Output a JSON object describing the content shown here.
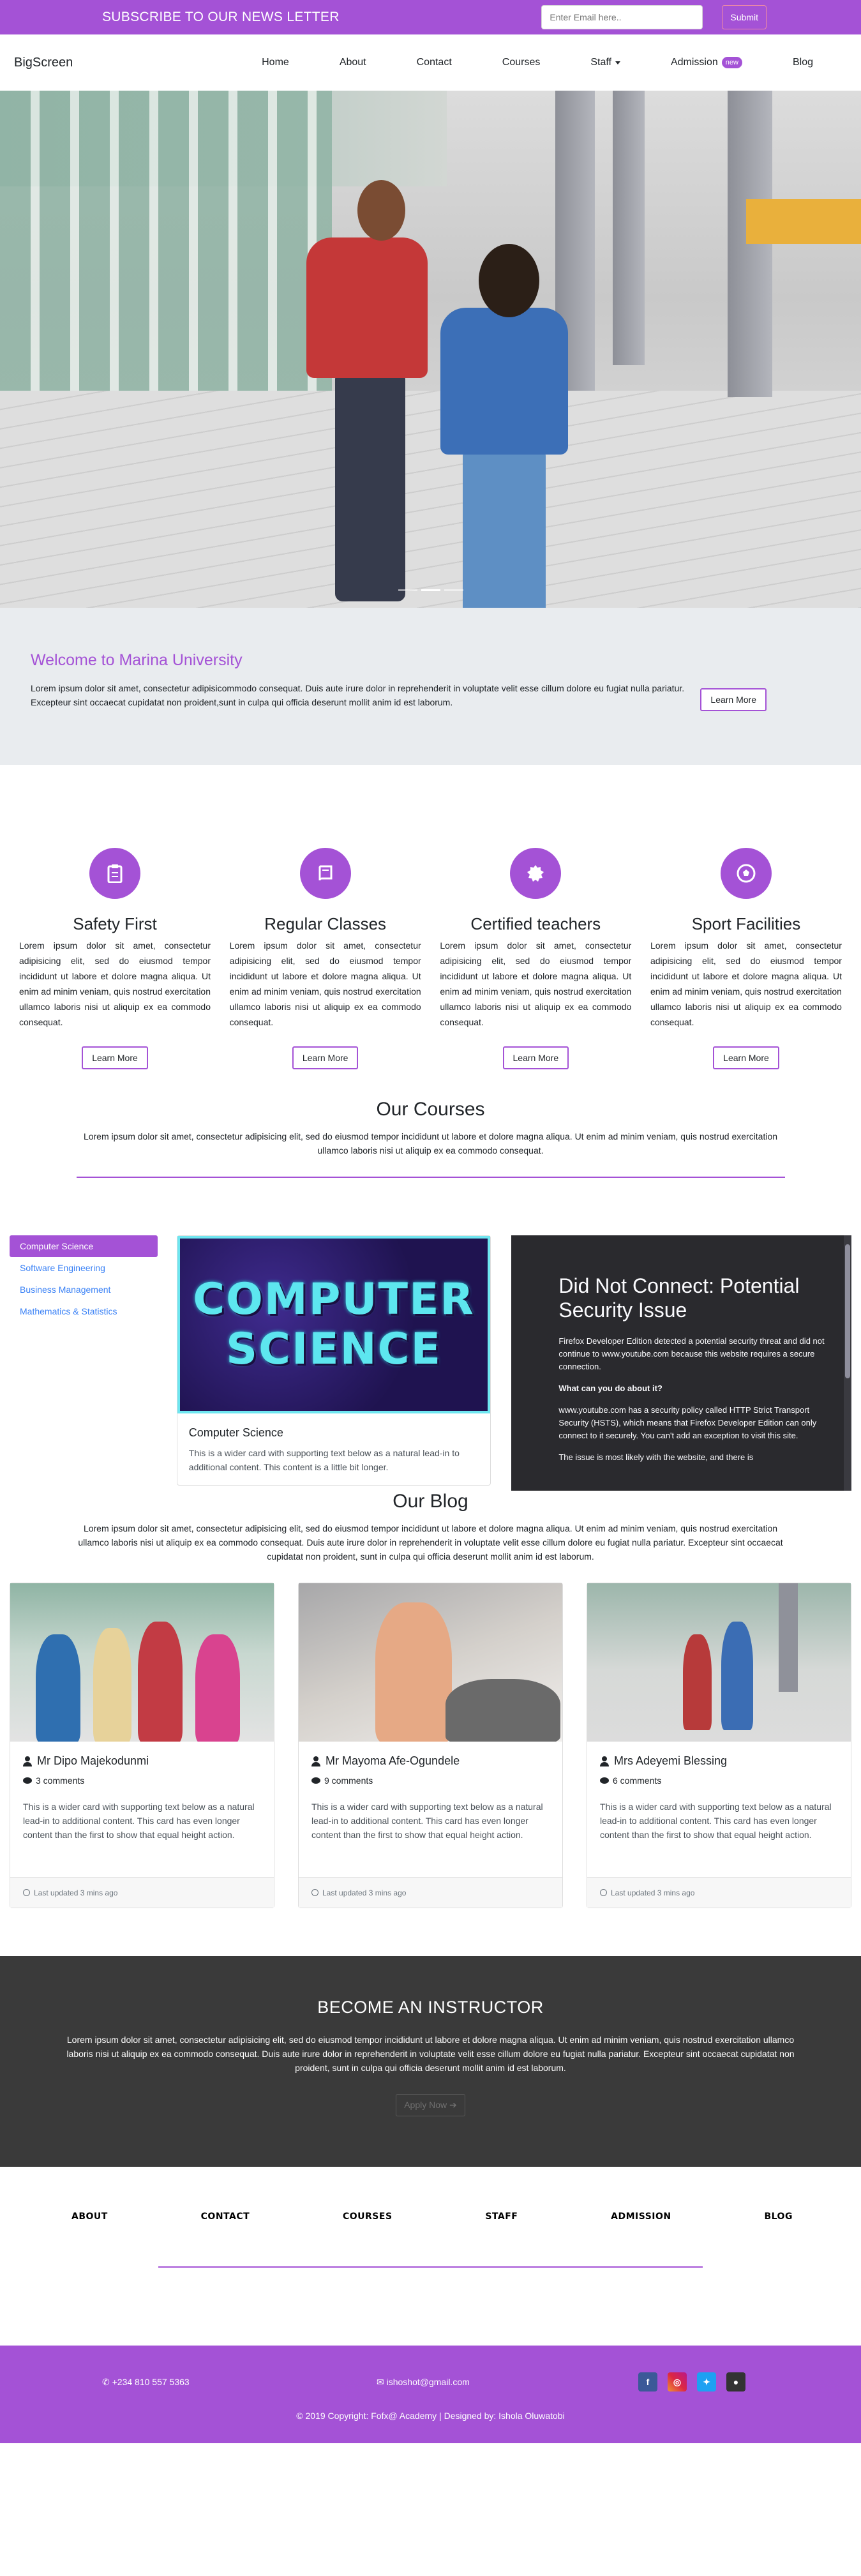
{
  "subscribe": {
    "title": "SUBSCRIBE TO OUR NEWS LETTER",
    "placeholder": "Enter Email here..",
    "button": "Submit"
  },
  "nav": {
    "brand": "BigScreen",
    "links": [
      "Home",
      "About",
      "Contact",
      "Courses",
      "Staff",
      "Admission",
      "Blog"
    ],
    "badge": "new"
  },
  "welcome": {
    "title": "Welcome to Marina University",
    "text": "Lorem ipsum dolor sit amet, consectetur adipisicommodo consequat. Duis aute irure dolor in reprehenderit in voluptate velit esse cillum dolore eu fugiat nulla pariatur. Excepteur sint occaecat cupidatat non proident,sunt in culpa qui officia deserunt mollit anim id est laborum.",
    "button": "Learn More"
  },
  "features": [
    {
      "icon": "clipboard-icon",
      "title": "Safety First",
      "text": "Lorem ipsum dolor sit amet, consectetur adipisicing elit, sed do eiusmod tempor incididunt ut labore et dolore magna aliqua. Ut enim ad minim veniam, quis nostrud exercitation ullamco laboris nisi ut aliquip ex ea commodo consequat.",
      "button": "Learn More"
    },
    {
      "icon": "book-icon",
      "title": "Regular Classes",
      "text": "Lorem ipsum dolor sit amet, consectetur adipisicing elit, sed do eiusmod tempor incididunt ut labore et dolore magna aliqua. Ut enim ad minim veniam, quis nostrud exercitation ullamco laboris nisi ut aliquip ex ea commodo consequat.",
      "button": "Learn More"
    },
    {
      "icon": "certificate-icon",
      "title": "Certified teachers",
      "text": "Lorem ipsum dolor sit amet, consectetur adipisicing elit, sed do eiusmod tempor incididunt ut labore et dolore magna aliqua. Ut enim ad minim veniam, quis nostrud exercitation ullamco laboris nisi ut aliquip ex ea commodo consequat.",
      "button": "Learn More"
    },
    {
      "icon": "football-icon",
      "title": "Sport Facilities",
      "text": "Lorem ipsum dolor sit amet, consectetur adipisicing elit, sed do eiusmod tempor incididunt ut labore et dolore magna aliqua. Ut enim ad minim veniam, quis nostrud exercitation ullamco laboris nisi ut aliquip ex ea commodo consequat.",
      "button": "Learn More"
    }
  ],
  "courses": {
    "title": "Our Courses",
    "text": "Lorem ipsum dolor sit amet, consectetur adipisicing elit, sed do eiusmod tempor incididunt ut labore et dolore magna aliqua. Ut enim ad minim veniam, quis nostrud exercitation ullamco laboris nisi ut aliquip ex ea commodo consequat.",
    "list": [
      "Computer Science",
      "Software Engineering",
      "Business Management",
      "Mathematics & Statistics"
    ],
    "card": {
      "image_line1": "COMPUTER",
      "image_line2": "SCIENCE",
      "title": "Computer Science",
      "text": "This is a wider card with supporting text below as a natural lead-in to additional content. This content is a little bit longer."
    },
    "embed": {
      "title": "Did Not Connect: Potential Security Issue",
      "p1": "Firefox Developer Edition detected a potential security threat and did not continue to www.youtube.com because this website requires a secure connection.",
      "heading": "What can you do about it?",
      "p2": "www.youtube.com has a security policy called HTTP Strict Transport Security (HSTS), which means that Firefox Developer Edition can only connect to it securely. You can't add an exception to visit this site.",
      "p3": "The issue is most likely with the website, and there is"
    }
  },
  "blog": {
    "title": "Our Blog",
    "text": "Lorem ipsum dolor sit amet, consectetur adipisicing elit, sed do eiusmod tempor incididunt ut labore et dolore magna aliqua. Ut enim ad minim veniam, quis nostrud exercitation ullamco laboris nisi ut aliquip ex ea commodo consequat. Duis aute irure dolor in reprehenderit in voluptate velit esse cillum dolore eu fugiat nulla pariatur. Excepteur sint occaecat cupidatat non proident, sunt in culpa qui officia deserunt mollit anim id est laborum.",
    "cards": [
      {
        "author": "Mr Dipo Majekodunmi",
        "comments": "3 comments",
        "text": "This is a wider card with supporting text below as a natural lead-in to additional content. This card has even longer content than the first to show that equal height action.",
        "updated": "Last updated 3 mins ago"
      },
      {
        "author": "Mr Mayoma Afe-Ogundele",
        "comments": "9 comments",
        "text": "This is a wider card with supporting text below as a natural lead-in to additional content. This card has even longer content than the first to show that equal height action.",
        "updated": "Last updated 3 mins ago"
      },
      {
        "author": "Mrs Adeyemi Blessing",
        "comments": "6 comments",
        "text": "This is a wider card with supporting text below as a natural lead-in to additional content. This card has even longer content than the first to show that equal height action.",
        "updated": "Last updated 3 mins ago"
      }
    ]
  },
  "instructor": {
    "title": "BECOME AN INSTRUCTOR",
    "text": "Lorem ipsum dolor sit amet, consectetur adipisicing elit, sed do eiusmod tempor incididunt ut labore et dolore magna aliqua. Ut enim ad minim veniam, quis nostrud exercitation ullamco laboris nisi ut aliquip ex ea commodo consequat. Duis aute irure dolor in reprehenderit in voluptate velit esse cillum dolore eu fugiat nulla pariatur. Excepteur sint occaecat cupidatat non proident, sunt in culpa qui officia deserunt mollit anim id est laborum.",
    "button": "Apply Now"
  },
  "footer": {
    "links": [
      "ABOUT",
      "CONTACT",
      "COURSES",
      "STAFF",
      "ADMISSION",
      "BLOG"
    ],
    "phone": "+234 810 557 5363",
    "email": "ishoshot@gmail.com",
    "socials": [
      "facebook-icon",
      "instagram-icon",
      "twitter-icon",
      "github-icon"
    ],
    "copyright": "© 2019 Copyright: Fofx@ Academy | Designed by: Ishola Oluwatobi"
  },
  "colors": {
    "accent": "#a452d6",
    "dark": "#3a3a3a",
    "link": "#3b82f6"
  }
}
